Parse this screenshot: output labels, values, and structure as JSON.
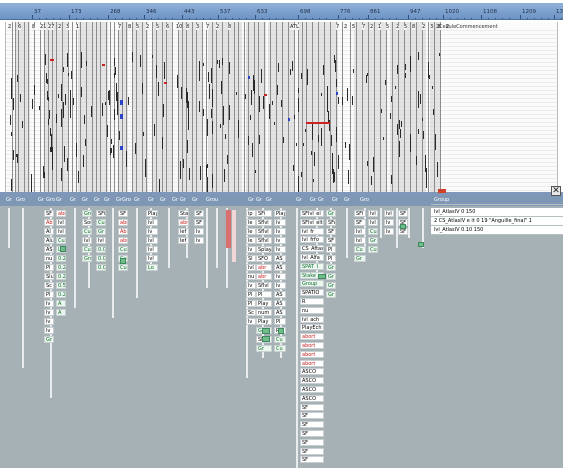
{
  "ruler": {
    "ticks": [
      "37",
      "173",
      "268",
      "346",
      "443",
      "537",
      "633",
      "698",
      "776",
      "861",
      "947",
      "1020",
      "1108",
      "1209",
      "1301"
    ]
  },
  "timeline": {
    "header_cells": [
      "2",
      "6",
      "8",
      "21",
      "27",
      "2",
      "3",
      "1",
      "7",
      "8",
      "5",
      "2",
      "5",
      "6",
      "10",
      "8",
      "3",
      "7",
      "2",
      "8",
      "ATL",
      "7",
      "2",
      "5",
      "7",
      "2",
      "1",
      "5",
      "2",
      "5",
      "8",
      "2",
      "3",
      "8",
      "2",
      "2",
      "Cell",
      "Commencement"
    ],
    "header_text": "2CelluleCommencement"
  },
  "panel": {
    "header_labels": [
      "Gr",
      "Gro",
      "Gr",
      "Gro",
      "Gr",
      "Gr",
      "Gr",
      "Gr",
      "Gr",
      "Gr",
      "Gro",
      "Gr",
      "Gr",
      "Gr",
      "Gr",
      "Gr",
      "Gr",
      "Grou",
      "Gr",
      "Gr",
      "Gr",
      "Gr",
      "Gr",
      "Gr",
      "Gr",
      "Gr",
      "Gro",
      "Group"
    ],
    "col1": [
      "SF",
      "Ab",
      "Al",
      "Alu",
      "AS",
      "nu",
      "Pl",
      "Slu",
      "Sc",
      "Pl",
      "lv",
      "lv",
      "lv",
      "lv",
      "Gr"
    ],
    "col2": [
      "abr",
      "lvl",
      "lvl",
      "Cur",
      "Lo",
      "0.2",
      "0.2",
      "0.2",
      "0.5",
      "0.2",
      "A",
      "A"
    ],
    "col3": [
      "Gro",
      "Sou",
      "Cur",
      "lvl",
      "Cur",
      "Gro"
    ],
    "col4": [
      "SFi",
      "Cu",
      "Gr",
      "lvl",
      "0.0",
      "0.0",
      "0.0"
    ],
    "col5": [
      "SF",
      "abr",
      "Ab",
      "abr",
      "Cu",
      "Cu",
      "Cu"
    ],
    "col6": [
      "Play",
      "lvl",
      "lv",
      "lvl",
      "lvl",
      "lvl",
      "Lo"
    ],
    "col7": [
      "Sta",
      "abr",
      "lef",
      "lef"
    ],
    "col8": [
      "SF",
      "SF",
      "lv",
      "lv"
    ],
    "mid_col_a": [
      "ip",
      "le",
      "le",
      "le",
      "lv",
      "Sl",
      "lvl",
      "nu",
      "lv",
      "Pl",
      "Pl",
      "Sc",
      "lv"
    ],
    "mid_col_b": [
      "SFi",
      "Sflvl_",
      "Sflvl_",
      "Sflvl_",
      "Splay",
      "SFO_",
      "abr",
      "abr",
      "Sflvl",
      "Pl",
      "Play",
      "num",
      "Play",
      "Gr",
      "SFAT",
      "Gr"
    ],
    "mid_col_c": [
      "Play",
      "lv",
      "lv",
      "lv",
      "lv",
      "AS",
      "AS",
      "lv",
      "lv",
      "AS",
      "AS",
      "AS",
      "Pl",
      "Pl",
      "Cu",
      "Cu"
    ],
    "center_col": [
      "SFlvl_el",
      "SFlvl_elto",
      "lvl_fr",
      "lvl_frfo",
      "CS_Aftas",
      "lvl_Alfa",
      "SPAT_I",
      "Stake",
      "Group",
      "SPATIO",
      "R",
      "nu",
      "lvl_ach",
      "PlayEch",
      "abort",
      "abort",
      "abort",
      "abort",
      "ASCO",
      "ASCO",
      "ASCO",
      "ASCO",
      "SF",
      "SF",
      "SF",
      "SF",
      "SF",
      "SF",
      "SF"
    ],
    "center_col_b": [
      "Gr",
      "SFa",
      "SF",
      "SF",
      "Pl",
      "Pl",
      "Gr",
      "Gr",
      "Gr",
      "Gr"
    ],
    "right_col_a": [
      "SFl",
      "SF",
      "lvl",
      "lvl",
      "Cu",
      "Gr"
    ],
    "right_col_b": [
      "lvl",
      "lvl",
      "Cu",
      "Gr",
      "Cu"
    ],
    "right_col_c": [
      "lvl",
      "lv",
      "lv"
    ],
    "right_col_d": [
      "SF",
      "SF",
      "SF"
    ],
    "group_rows": [
      "lvl_AtlasIV  0  150",
      "2  CS_AtlasIV  e  it  0  19  \"Anguille_final\"  1",
      "lvl_AtlasIV  0.10  150"
    ],
    "group_header": "Group"
  },
  "colors": {
    "ruler": "#7a9dcc",
    "panel_bg": "#a5b1b4",
    "green_item": "#6fbd8a",
    "red_item": "#cc2222",
    "blue_mark": "#2b43c7"
  }
}
